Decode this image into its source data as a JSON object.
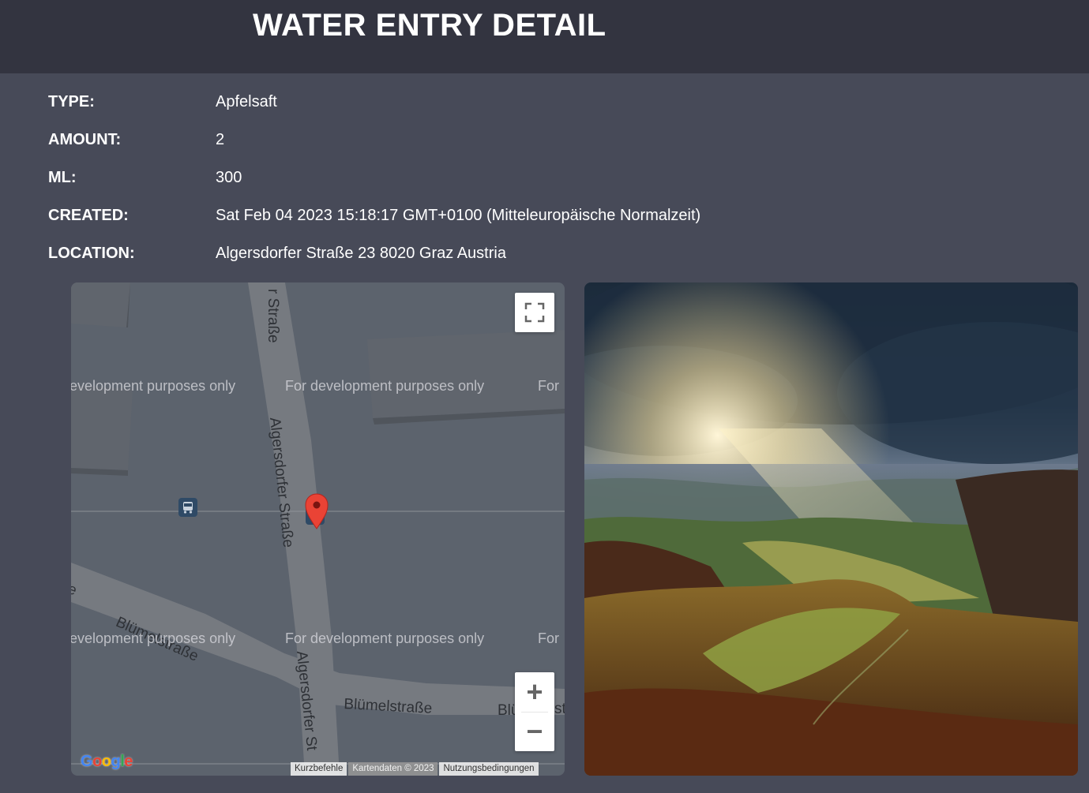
{
  "header": {
    "title": "WATER ENTRY DETAIL"
  },
  "details": {
    "type": {
      "label": "TYPE:",
      "value": "Apfelsaft"
    },
    "amount": {
      "label": "AMOUNT:",
      "value": "2"
    },
    "ml": {
      "label": "ML:",
      "value": "300"
    },
    "created": {
      "label": "CREATED:",
      "value": "Sat Feb 04 2023 15:18:17 GMT+0100 (Mitteleuropäische Normalzeit)"
    },
    "location": {
      "label": "LOCATION:",
      "value": "Algersdorfer Straße 23 8020 Graz Austria"
    }
  },
  "map": {
    "watermarks": {
      "top_left": "evelopment purposes only",
      "top_center": "For development purposes only",
      "top_right": "For",
      "bottom_left": "evelopment purposes only",
      "bottom_center": "For development purposes only",
      "bottom_right": "For"
    },
    "streets": {
      "top_fragment": "r Straße",
      "algersdorfer_main": "Algersdorfer Straße",
      "algersdorfer_lower": "Algersdorfer St",
      "bluemel_diag": "Blümelstraße",
      "bluemel_right": "Blümelstraße",
      "bluemel_far": "Blü",
      "left_fragment": "e",
      "right_fragment": "st"
    },
    "logo": "Google",
    "attribution": {
      "shortcuts": "Kurzbefehle",
      "map_data": "Kartendaten © 2023",
      "terms": "Nutzungsbedingungen"
    },
    "zoom_in_label": "+",
    "zoom_out_label": "−",
    "icons": {
      "fullscreen": "fullscreen-icon",
      "marker": "map-pin-icon",
      "bus_stop": "bus-stop-icon"
    }
  },
  "colors": {
    "page_bg": "#474a58",
    "header_bg": "#333440",
    "map_bg": "#5c636d",
    "marker": "#ea4335"
  }
}
